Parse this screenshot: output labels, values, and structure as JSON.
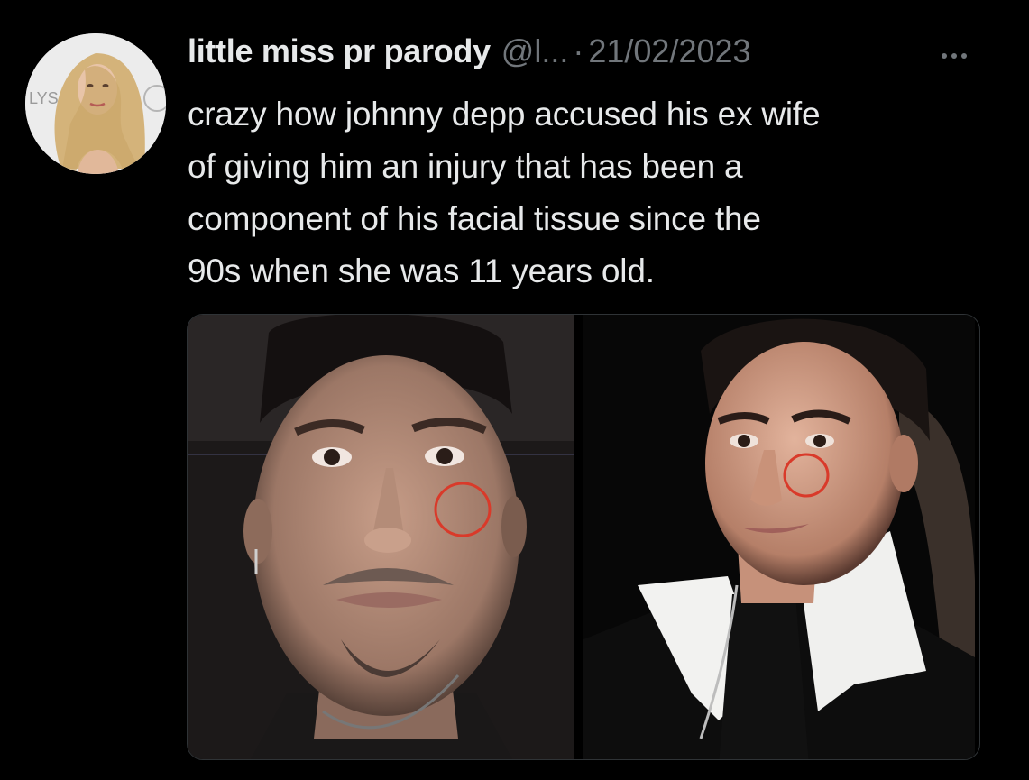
{
  "tweet": {
    "display_name": "little miss pr parody",
    "handle": "@l...",
    "separator": "·",
    "timestamp": "21/02/2023",
    "text_lines": [
      "crazy how johnny depp accused his ex wife",
      "of giving him an injury that has been a",
      "component of his facial tissue since the",
      "90s when she was 11 years old."
    ]
  },
  "avatar": {
    "icon": "profile-avatar",
    "backdrop_letters": "LYS AN"
  },
  "media": {
    "photos": [
      {
        "icon": "face-photo-recent",
        "annotation": "red-circle"
      },
      {
        "icon": "face-photo-1990s",
        "annotation": "red-circle"
      }
    ],
    "annotation_color": "#d93a2a"
  },
  "colors": {
    "background": "#000000",
    "primary_text": "#e7e9ea",
    "secondary_text": "#71767b",
    "border": "#2f3336"
  }
}
